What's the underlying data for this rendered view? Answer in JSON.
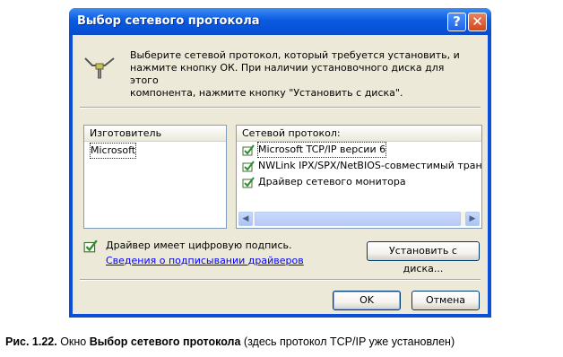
{
  "window": {
    "title": "Выбор сетевого протокола",
    "help_button": "?",
    "close_button": "✕"
  },
  "header": {
    "message_line1": "Выберите сетевой протокол, который требуется установить, и",
    "message_line2": "нажмите кнопку ОК. При наличии установочного диска для этого",
    "message_line3": "компонента, нажмите кнопку \"Установить с диска\".",
    "icon": "network-protocol-icon"
  },
  "manufacturer_list": {
    "header": "Изготовитель",
    "items": [
      "Microsoft"
    ]
  },
  "protocol_list": {
    "header": "Сетевой протокол:",
    "items": [
      "Microsoft TCP/IP версии 6",
      "NWLink IPX/SPX/NetBIOS-совместимый тран",
      "Драйвер сетевого монитора"
    ]
  },
  "signature": {
    "text": "Драйвер имеет цифровую подпись.",
    "link": "Сведения о подписывании драйверов"
  },
  "buttons": {
    "have_disk": "Установить с диска...",
    "ok": "OK",
    "cancel": "Отмена"
  },
  "caption": {
    "prefix": "Рис. 1.22.",
    "text1": " Окно ",
    "bold": "Выбор сетевого протокола",
    "text2": " (здесь протокол TCP/IP уже установлен)"
  },
  "colors": {
    "titlebar": "#0a5be0",
    "client": "#ece9d8",
    "link": "#0000ff"
  }
}
